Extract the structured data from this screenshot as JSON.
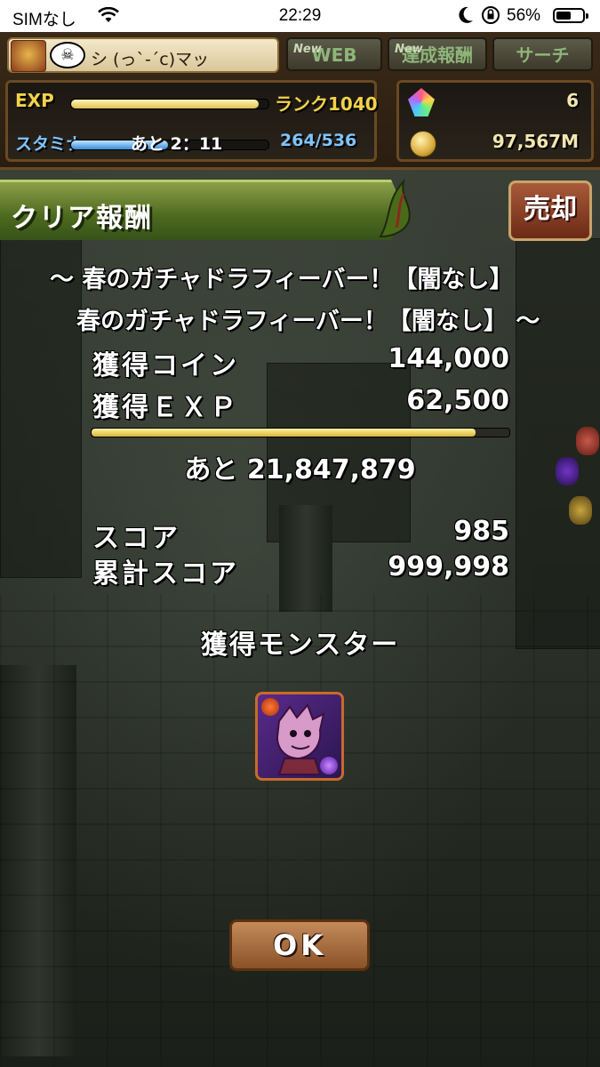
{
  "status_bar": {
    "carrier": "SIMなし",
    "time": "22:29",
    "battery_percent": "56%",
    "battery_level": 0.56,
    "icons": [
      "wifi-icon",
      "moon-icon",
      "orientation-lock-icon",
      "battery-icon"
    ]
  },
  "header": {
    "player_name": "シ (っ`-´c)マッ",
    "emblem_text": "☠",
    "buttons": [
      {
        "label": "WEB",
        "badge": "New"
      },
      {
        "label": "達成報酬",
        "badge": "New"
      },
      {
        "label": "サーチ",
        "badge": ""
      }
    ],
    "exp_label": "EXP",
    "exp_progress": 0.95,
    "rank": "ランク1040",
    "stamina_label": "スタミナ",
    "stamina_timer": "あと 2：11",
    "stamina_progress": 0.49,
    "stamina_value": "264/536",
    "magic_stones": "6",
    "coins": "97,567M"
  },
  "result": {
    "title": "クリア報酬",
    "sell_label": "売却",
    "dungeon_line1": "～ 春のガチャドラフィーバー！【闇なし】",
    "dungeon_line2": "春のガチャドラフィーバー！【闇なし】 ～",
    "coin_label": "獲得コイン",
    "coin_value": "144,000",
    "exp_label": "獲得ＥＸＰ",
    "exp_value": "62,500",
    "rank_progress": 0.92,
    "remaining": "あと 21,847,879",
    "score_label": "スコア",
    "score_value": "985",
    "total_score_label": "累計スコア",
    "total_score_value": "999,998",
    "monster_heading": "獲得モンスター",
    "ok_label": "OK"
  },
  "colors": {
    "banner_green": "#4e6a1e",
    "exp_yellow": "#f2d24a",
    "stamina_blue": "#7fc4ff",
    "sell_red": "#8a3a20",
    "ok_brown": "#a86c3e"
  }
}
